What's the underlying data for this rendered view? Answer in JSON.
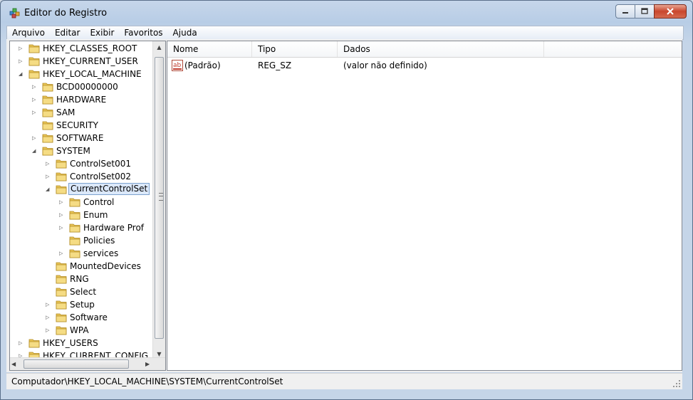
{
  "window": {
    "title": "Editor do Registro"
  },
  "menu": [
    "Arquivo",
    "Editar",
    "Exibir",
    "Favoritos",
    "Ajuda"
  ],
  "tree": [
    {
      "label": "HKEY_CLASSES_ROOT",
      "level": 0,
      "expander": "collapsed"
    },
    {
      "label": "HKEY_CURRENT_USER",
      "level": 0,
      "expander": "collapsed"
    },
    {
      "label": "HKEY_LOCAL_MACHINE",
      "level": 0,
      "expander": "expanded"
    },
    {
      "label": "BCD00000000",
      "level": 1,
      "expander": "collapsed"
    },
    {
      "label": "HARDWARE",
      "level": 1,
      "expander": "collapsed"
    },
    {
      "label": "SAM",
      "level": 1,
      "expander": "collapsed"
    },
    {
      "label": "SECURITY",
      "level": 1,
      "expander": "none"
    },
    {
      "label": "SOFTWARE",
      "level": 1,
      "expander": "collapsed"
    },
    {
      "label": "SYSTEM",
      "level": 1,
      "expander": "expanded"
    },
    {
      "label": "ControlSet001",
      "level": 2,
      "expander": "collapsed"
    },
    {
      "label": "ControlSet002",
      "level": 2,
      "expander": "collapsed"
    },
    {
      "label": "CurrentControlSet",
      "level": 2,
      "expander": "expanded",
      "selected": true
    },
    {
      "label": "Control",
      "level": 3,
      "expander": "collapsed"
    },
    {
      "label": "Enum",
      "level": 3,
      "expander": "collapsed"
    },
    {
      "label": "Hardware Prof",
      "level": 3,
      "expander": "collapsed"
    },
    {
      "label": "Policies",
      "level": 3,
      "expander": "none"
    },
    {
      "label": "services",
      "level": 3,
      "expander": "collapsed"
    },
    {
      "label": "MountedDevices",
      "level": 2,
      "expander": "none"
    },
    {
      "label": "RNG",
      "level": 2,
      "expander": "none"
    },
    {
      "label": "Select",
      "level": 2,
      "expander": "none"
    },
    {
      "label": "Setup",
      "level": 2,
      "expander": "collapsed"
    },
    {
      "label": "Software",
      "level": 2,
      "expander": "collapsed"
    },
    {
      "label": "WPA",
      "level": 2,
      "expander": "collapsed"
    },
    {
      "label": "HKEY_USERS",
      "level": 0,
      "expander": "collapsed"
    },
    {
      "label": "HKEY_CURRENT_CONFIG",
      "level": 0,
      "expander": "collapsed"
    }
  ],
  "list": {
    "columns": [
      "Nome",
      "Tipo",
      "Dados"
    ],
    "rows": [
      {
        "icon": "string-value-icon",
        "icon_text": "ab",
        "name": "(Padrão)",
        "type": "REG_SZ",
        "data": "(valor não definido)"
      }
    ]
  },
  "status": {
    "path": "Computador\\HKEY_LOCAL_MACHINE\\SYSTEM\\CurrentControlSet"
  },
  "colors": {
    "selection_bg": "#dbe8fa",
    "selection_border": "#7da2ce",
    "folder": "#f2d36b",
    "close_button": "#c9462c"
  }
}
